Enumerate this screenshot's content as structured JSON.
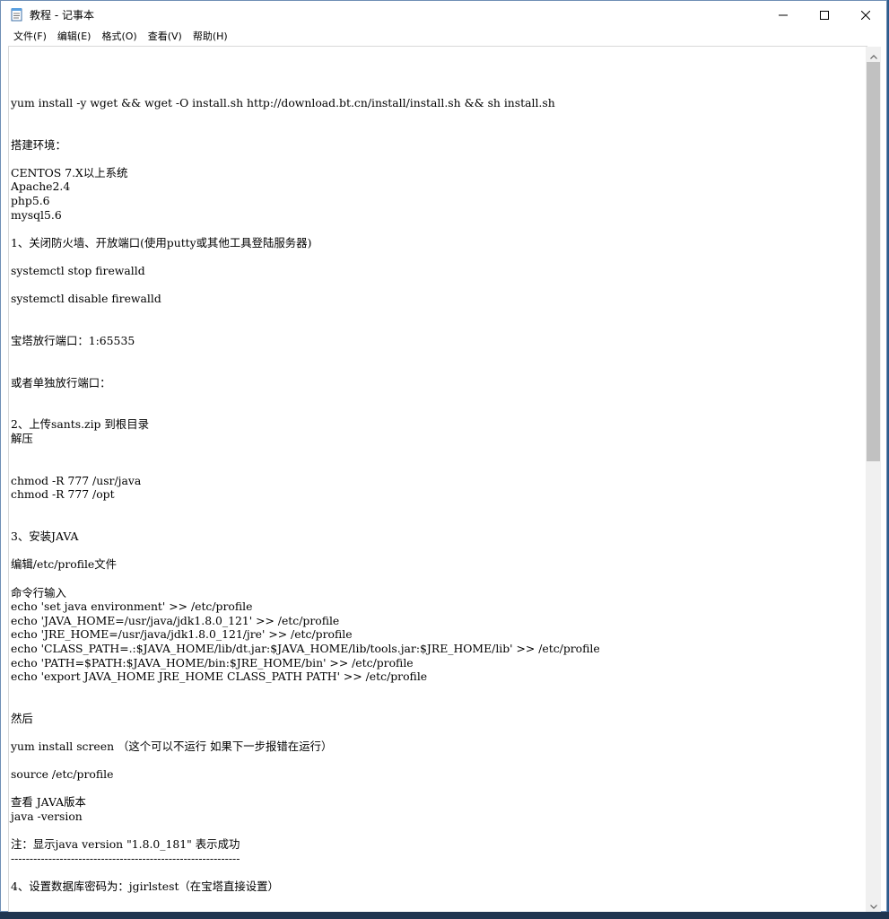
{
  "window": {
    "title": "教程 - 记事本",
    "controls": [
      "minimize",
      "maximize",
      "close"
    ]
  },
  "menu": {
    "items": [
      "文件(F)",
      "编辑(E)",
      "格式(O)",
      "查看(V)",
      "帮助(H)"
    ]
  },
  "icons": {
    "app": "notepad-icon",
    "minimize": "minimize-icon",
    "maximize": "maximize-icon",
    "close": "close-icon",
    "scroll_up": "chevron-up-icon",
    "scroll_down": "chevron-down-icon"
  },
  "document": {
    "lines": [
      "",
      "",
      "",
      "yum install -y wget && wget -O install.sh http://download.bt.cn/install/install.sh && sh install.sh",
      "",
      "",
      "搭建环境：",
      "",
      "CENTOS 7.X以上系统",
      "Apache2.4",
      "php5.6",
      "mysql5.6",
      "",
      "1、关闭防火墙、开放端口(使用putty或其他工具登陆服务器)",
      "",
      "systemctl stop firewalld",
      "",
      "systemctl disable firewalld",
      "",
      "",
      "宝塔放行端口：1:65535",
      "",
      "",
      "或者单独放行端口：",
      "",
      "",
      "2、上传sants.zip 到根目录",
      "解压",
      "",
      "",
      "chmod -R 777 /usr/java",
      "chmod -R 777 /opt",
      "",
      "",
      "3、安装JAVA",
      "",
      "编辑/etc/profile文件",
      "",
      "命令行输入",
      "echo 'set java environment' >> /etc/profile",
      "echo 'JAVA_HOME=/usr/java/jdk1.8.0_121' >> /etc/profile",
      "echo 'JRE_HOME=/usr/java/jdk1.8.0_121/jre' >> /etc/profile",
      "echo 'CLASS_PATH=.:$JAVA_HOME/lib/dt.jar:$JAVA_HOME/lib/tools.jar:$JRE_HOME/lib' >> /etc/profile",
      "echo 'PATH=$PATH:$JAVA_HOME/bin:$JRE_HOME/bin' >> /etc/profile",
      "echo 'export JAVA_HOME JRE_HOME CLASS_PATH PATH' >> /etc/profile",
      "",
      "",
      "然后",
      "",
      "yum install screen （这个可以不运行 如果下一步报错在运行）",
      "",
      "source /etc/profile",
      "",
      "查看 JAVA版本",
      "java -version",
      "",
      "注：显示java version \"1.8.0_181\" 表示成功",
      "-------------------------------------------------------------",
      "",
      "4、设置数据库密码为：jgirlstest（在宝塔直接设置）",
      "",
      ""
    ]
  }
}
